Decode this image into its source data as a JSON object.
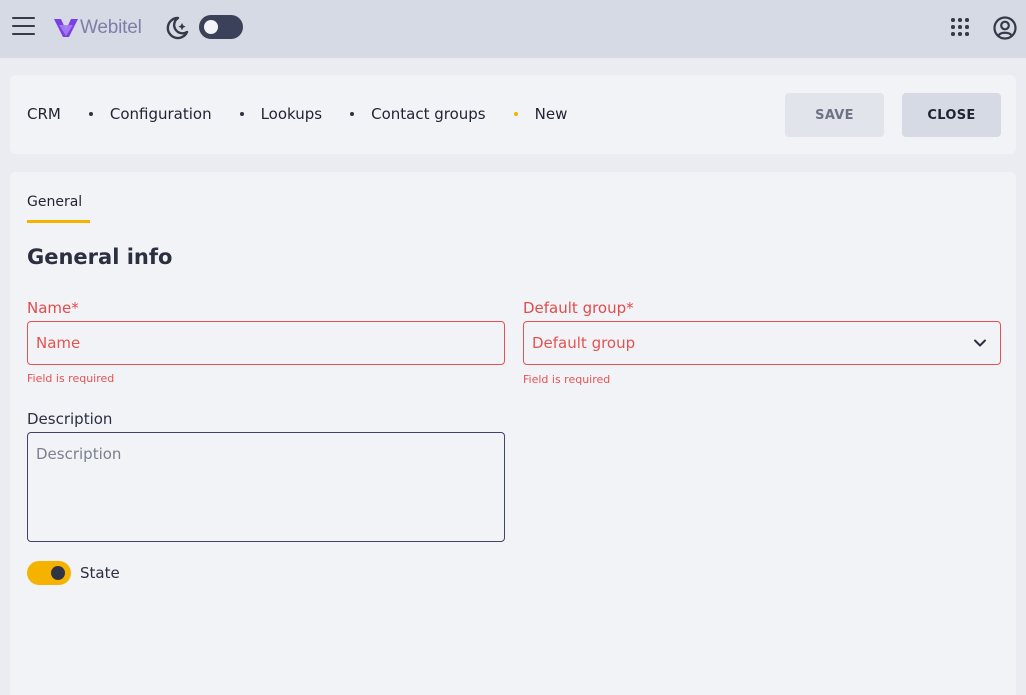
{
  "app": {
    "brand_name": "Webitel",
    "brand_color": "#7b3fe4",
    "accent_color": "#f5b300",
    "error_color": "#e35353"
  },
  "topbar": {
    "menu_icon": "hamburger-menu-icon",
    "theme_icon": "moon-stars-icon",
    "dark_mode_enabled": false,
    "apps_icon": "apps-grid-icon",
    "account_icon": "account-circle-icon"
  },
  "breadcrumb": {
    "items": [
      "CRM",
      "Configuration",
      "Lookups",
      "Contact groups",
      "New"
    ]
  },
  "actions": {
    "save_label": "SAVE",
    "close_label": "CLOSE"
  },
  "tabs": [
    {
      "label": "General",
      "active": true
    }
  ],
  "form": {
    "section_title": "General info",
    "name": {
      "label": "Name*",
      "placeholder": "Name",
      "value": "",
      "error": "Field is required"
    },
    "default_group": {
      "label": "Default group*",
      "placeholder": "Default group",
      "value": "",
      "error": "Field is required"
    },
    "description": {
      "label": "Description",
      "placeholder": "Description",
      "value": ""
    },
    "state": {
      "label": "State",
      "enabled": true
    }
  }
}
